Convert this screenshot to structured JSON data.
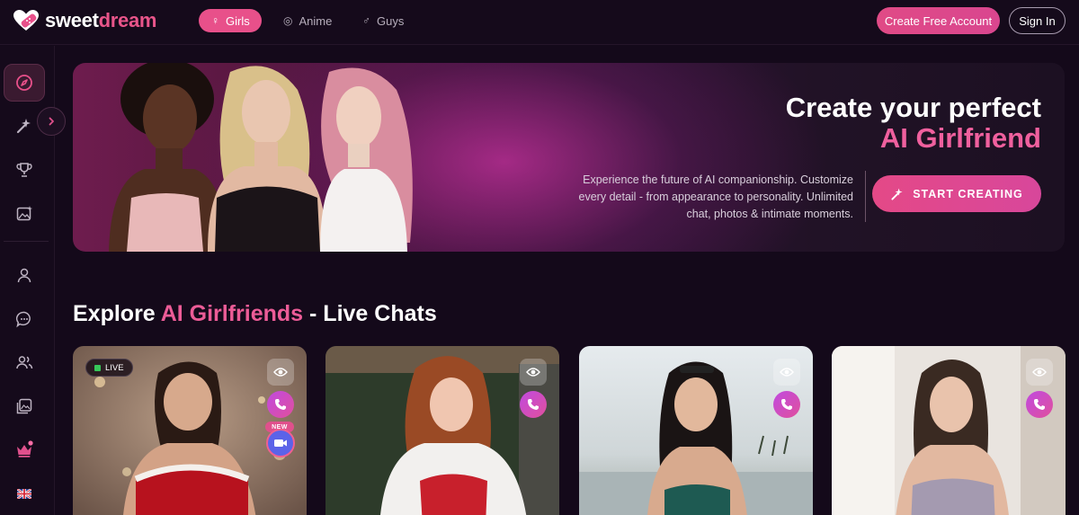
{
  "brand": {
    "logo_part1": "sweet",
    "logo_part2": "dream",
    "logo_icon": "heart-bandage-icon",
    "accent_color": "#e8508a"
  },
  "nav": {
    "tabs": [
      {
        "label": "Girls",
        "icon": "female-symbol-icon",
        "active": true
      },
      {
        "label": "Anime",
        "icon": "spiral-icon",
        "active": false
      },
      {
        "label": "Guys",
        "icon": "male-symbol-icon",
        "active": false
      }
    ]
  },
  "header": {
    "create_account_label": "Create Free Account",
    "signin_label": "Sign In"
  },
  "sidebar": {
    "items": [
      {
        "icon": "compass-icon",
        "active": true
      },
      {
        "icon": "magic-wand-icon",
        "active": false
      },
      {
        "icon": "trophy-icon",
        "active": false
      },
      {
        "icon": "image-sparkle-icon",
        "active": false
      },
      {
        "icon": "user-icon",
        "active": false
      },
      {
        "icon": "chat-bubble-icon",
        "active": false
      },
      {
        "icon": "users-icon",
        "active": false
      },
      {
        "icon": "gallery-icon",
        "active": false
      },
      {
        "icon": "crown-icon",
        "active": false
      },
      {
        "icon": "uk-flag-icon",
        "active": false
      }
    ],
    "expand_icon": "chevron-right-icon"
  },
  "hero": {
    "title_line1": "Create your perfect",
    "title_line2": "AI Girlfriend",
    "description": "Experience the future of AI companionship. Customize every detail - from appearance to personality. Unlimited chat, photos & intimate moments.",
    "cta_label": "START CREATING",
    "cta_icon": "magic-wand-icon"
  },
  "section": {
    "title_prefix": "Explore ",
    "title_accent": "AI Girlfriends",
    "title_suffix": " - Live Chats"
  },
  "cards": [
    {
      "live_label": "LIVE",
      "new_label": "NEW",
      "has_video": true
    },
    {
      "has_video": false
    },
    {
      "has_video": false
    },
    {
      "has_video": false
    }
  ]
}
